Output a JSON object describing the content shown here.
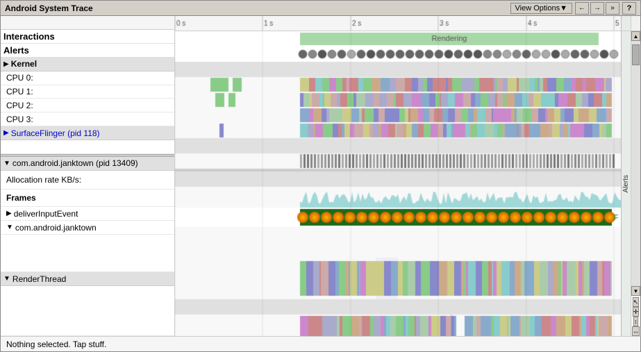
{
  "title": "Android System Trace",
  "toolbar": {
    "view_options_label": "View Options▼",
    "nav_back": "←",
    "nav_forward": "→",
    "nav_more": "»",
    "help": "?"
  },
  "timeline": {
    "ticks": [
      "0 s",
      "1 s",
      "2 s",
      "3 s",
      "4 s",
      "5 s"
    ]
  },
  "sidebar_right_label": "Alerts",
  "rows": [
    {
      "id": "interactions",
      "label": "Interactions",
      "type": "bold"
    },
    {
      "id": "alerts",
      "label": "Alerts",
      "type": "bold"
    },
    {
      "id": "kernel",
      "label": "▶ Kernel",
      "type": "section-header"
    },
    {
      "id": "cpu0",
      "label": "CPU 0:",
      "type": "indented"
    },
    {
      "id": "cpu1",
      "label": "CPU 1:",
      "type": "indented"
    },
    {
      "id": "cpu2",
      "label": "CPU 2:",
      "type": "indented"
    },
    {
      "id": "cpu3",
      "label": "CPU 3:",
      "type": "indented"
    },
    {
      "id": "surfaceflinger",
      "label": "▶ SurfaceFlinger (pid 118)",
      "type": "section-header-link"
    },
    {
      "id": "sf-content",
      "label": "",
      "type": "content"
    },
    {
      "id": "janktown",
      "label": "▼ com.android.janktown (pid 13409)",
      "type": "section-header"
    },
    {
      "id": "allocation",
      "label": "Allocation rate KB/s:",
      "type": "indented"
    },
    {
      "id": "frames",
      "label": "Frames",
      "type": "indented-bold"
    },
    {
      "id": "deliver",
      "label": "▶ deliverInputEvent",
      "type": "indented"
    },
    {
      "id": "com-android",
      "label": "▼ com.android.janktown",
      "type": "indented"
    },
    {
      "id": "render-thread",
      "label": "▼ RenderThread",
      "type": "section-header"
    }
  ],
  "status": {
    "text": "Nothing selected. Tap stuff."
  },
  "colors": {
    "rendering_bar": "#a8d8a8",
    "cpu_multi": true,
    "frames_bar": "#228b22",
    "alert_circles": "#666"
  }
}
